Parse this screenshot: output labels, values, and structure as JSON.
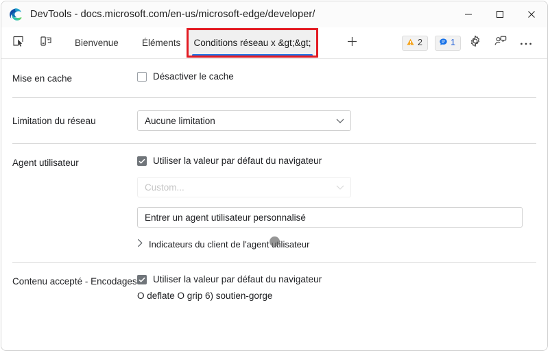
{
  "window": {
    "title": "DevTools - docs.microsoft.com/en-us/microsoft-edge/developer/",
    "logo_icon": "edge-logo-icon",
    "minimize_icon": "minimize-icon",
    "maximize_icon": "maximize-icon",
    "close_icon": "close-icon"
  },
  "toolbar": {
    "inspect_icon": "inspect-element-icon",
    "device_icon": "device-emulation-icon",
    "tabs": [
      {
        "label": "Bienvenue",
        "active": false
      },
      {
        "label": "Éléments",
        "active": false
      },
      {
        "label": "Conditions réseau x &gt;&gt;",
        "active": true
      }
    ],
    "add_tab_icon": "plus-icon",
    "badges": [
      {
        "name": "warning-badge",
        "icon": "warning-triangle-icon",
        "count": "2",
        "color": "#f5a623"
      },
      {
        "name": "message-badge",
        "icon": "message-bubble-icon",
        "count": "1",
        "color": "#1a73e8"
      }
    ],
    "settings_icon": "gear-icon",
    "feedback_icon": "feedback-person-icon",
    "more_icon": "more-options-icon"
  },
  "highlight": {
    "color": "#e31b23"
  },
  "panel": {
    "caching": {
      "label": "Mise en cache",
      "checkbox_label": "Désactiver le cache",
      "checked": false
    },
    "throttling": {
      "label": "Limitation du réseau",
      "value": "Aucune limitation",
      "caret_icon": "chevron-down-icon"
    },
    "user_agent": {
      "label": "Agent utilisateur",
      "checkbox_label": "Utiliser la valeur par défaut du navigateur",
      "checked": true,
      "select_value": "Custom...",
      "select_disabled": true,
      "input_value": "Entrer un agent utilisateur personnalisé",
      "disclosure_label": "Indicateurs du client de l'agent utilisateur",
      "disclosure_icon": "chevron-right-icon"
    },
    "accepted_content": {
      "label": "Contenu accepté - Encodages",
      "checkbox_label": "Utiliser la valeur par défaut du navigateur",
      "checked": true,
      "encodings_line": "O deflate O grip 6) soutien-gorge"
    }
  }
}
